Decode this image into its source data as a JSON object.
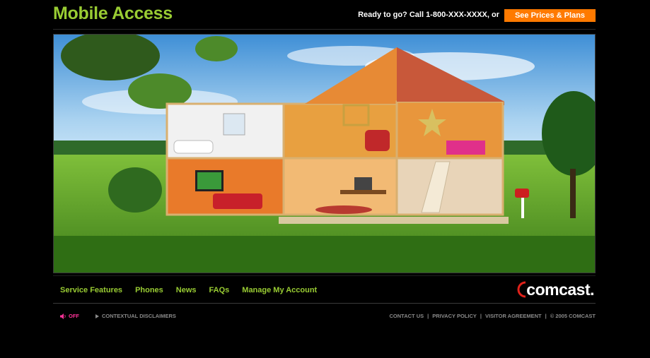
{
  "header": {
    "title": "Mobile Access",
    "cta_text": "Ready to go? Call 1-800-XXX-XXXX, or",
    "cta_button": "See Prices & Plans"
  },
  "hero": {
    "alt_icon": "house-cutaway-illustration"
  },
  "nav": {
    "items": [
      "Service Features",
      "Phones",
      "News",
      "FAQs",
      "Manage My Account"
    ],
    "logo": "comcast."
  },
  "footer": {
    "sound_label": "OFF",
    "disclaimers_label": "CONTEXTUAL DISCLAIMERS",
    "links": [
      "CONTACT US",
      "PRIVACY POLICY",
      "VISITOR AGREEMENT",
      "© 2005 COMCAST"
    ]
  },
  "colors": {
    "accent_green": "#99cc33",
    "cta_orange": "#ff7a00",
    "sound_pink": "#ff3399",
    "footer_gray": "#8a8a8a"
  }
}
